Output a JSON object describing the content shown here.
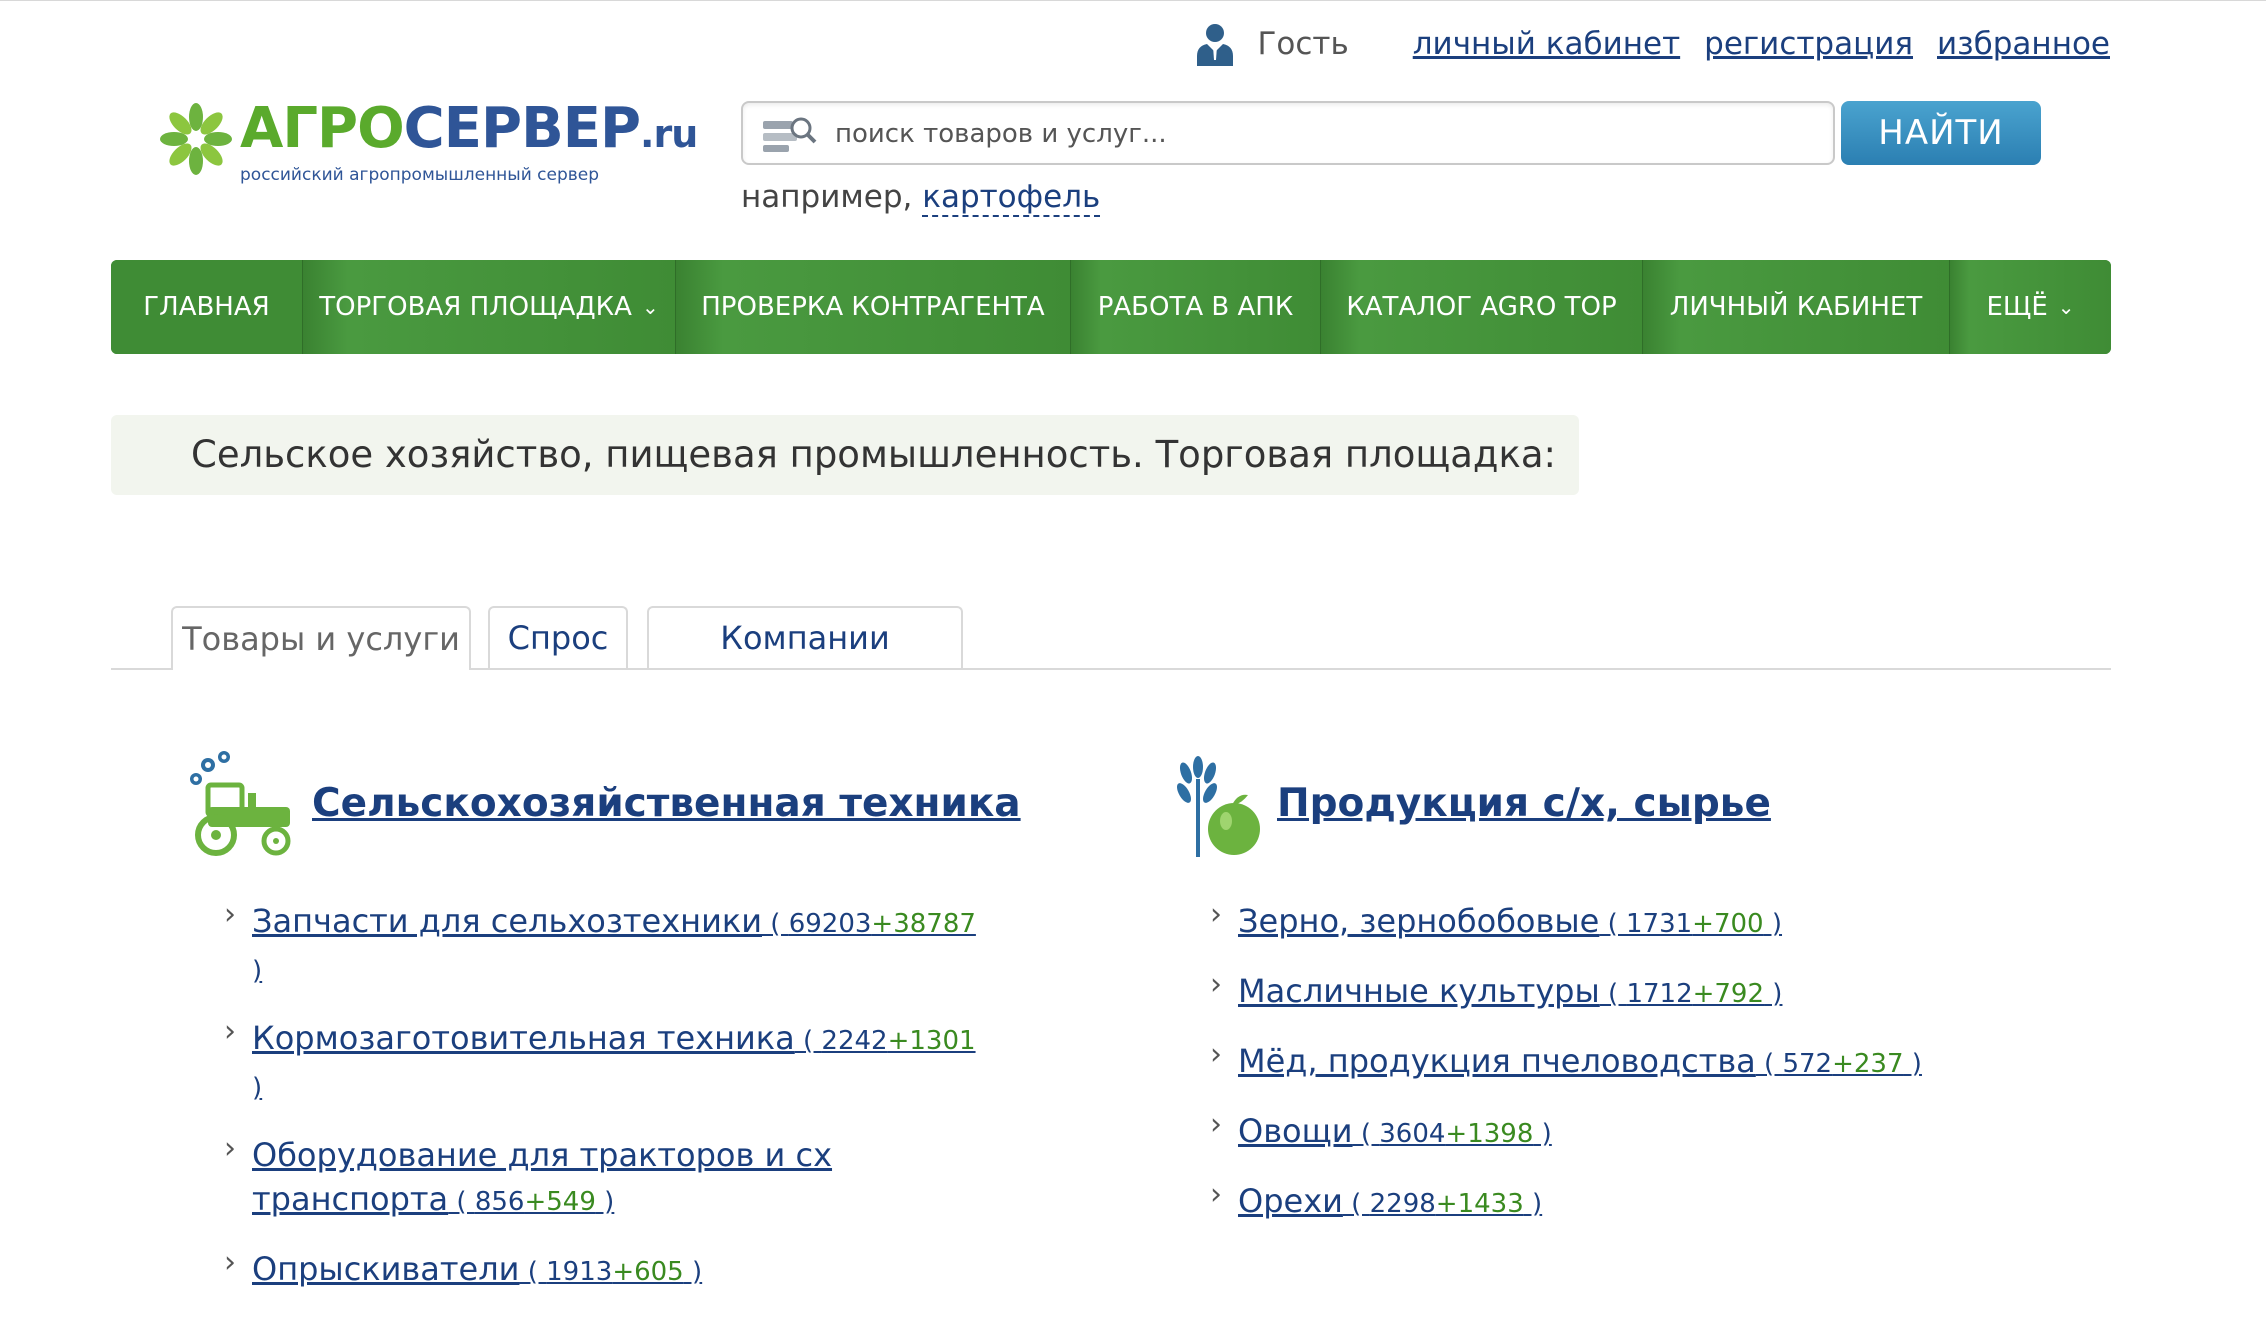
{
  "userbar": {
    "guest": "Гость",
    "links": [
      "личный кабинет",
      "регистрация",
      "избранное"
    ]
  },
  "logo": {
    "word_green": "АГРО",
    "word_blue": "СЕРВЕР",
    "word_domain": ".ru",
    "tagline": "российский агропромышленный сервер"
  },
  "search": {
    "placeholder": "поиск товаров и услуг...",
    "button": "НАЙТИ",
    "example_prefix": "например,",
    "example_link": "картофель"
  },
  "nav": [
    {
      "label": "ГЛАВНАЯ",
      "dropdown": false
    },
    {
      "label": "ТОРГОВАЯ ПЛОЩАДКА",
      "dropdown": true
    },
    {
      "label": "ПРОВЕРКА КОНТРАГЕНТА",
      "dropdown": false
    },
    {
      "label": "РАБОТА В АПК",
      "dropdown": false
    },
    {
      "label": "КАТАЛОГ AGRO TOP",
      "dropdown": false
    },
    {
      "label": "ЛИЧНЫЙ КАБИНЕТ",
      "dropdown": false
    },
    {
      "label": "ЕЩЁ",
      "dropdown": true
    }
  ],
  "heading": "Сельское хозяйство, пищевая промышленность. Торговая площадка:",
  "tabs": [
    "Товары и услуги",
    "Спрос",
    "Компании"
  ],
  "categories": [
    {
      "title": "Сельскохозяйственная техника",
      "icon": "tractor-icon",
      "items": [
        {
          "label": "Запчасти для сельхозтехники",
          "count": "69203",
          "added": "+38787"
        },
        {
          "label": "Кормозаготовительная техника",
          "count": "2242",
          "added": "+1301"
        },
        {
          "label": "Оборудование для тракторов и сх транспорта",
          "count": "856",
          "added": "+549"
        },
        {
          "label": "Опрыскиватели",
          "count": "1913",
          "added": "+605"
        }
      ]
    },
    {
      "title": "Продукция с/х, сырье",
      "icon": "wheat-apple-icon",
      "items": [
        {
          "label": "Зерно, зернобобовые",
          "count": "1731",
          "added": "+700"
        },
        {
          "label": "Масличные культуры",
          "count": "1712",
          "added": "+792"
        },
        {
          "label": "Мёд, продукция пчеловодства",
          "count": "572",
          "added": "+237"
        },
        {
          "label": "Овощи",
          "count": "3604",
          "added": "+1398"
        },
        {
          "label": "Орехи",
          "count": "2298",
          "added": "+1433"
        }
      ]
    }
  ],
  "colors": {
    "nav_green": "#3f8c35",
    "link_blue": "#1b3f7e",
    "count_green": "#3a8a20",
    "button_blue": "#2b7fb2"
  }
}
